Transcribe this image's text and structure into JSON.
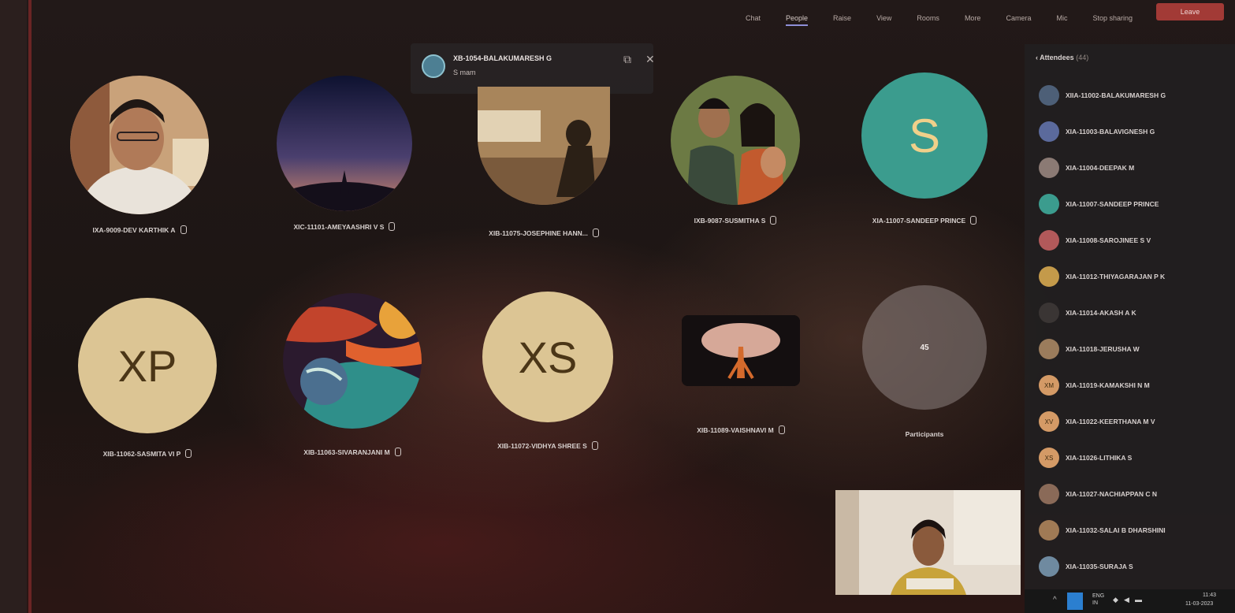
{
  "header": {
    "menu": [
      "Chat",
      "People",
      "Raise",
      "View",
      "Rooms",
      "More",
      "Camera",
      "Mic",
      "Stop sharing"
    ],
    "active_menu": "People",
    "leave_label": "Leave"
  },
  "notification": {
    "sender": "XB-1054-BALAKUMARESH G",
    "message": "S mam",
    "pop_out_icon": "pop-out-icon",
    "close_icon": "close-icon"
  },
  "tiles": [
    {
      "name": "IXA-9009-DEV KARTHIK A",
      "kind": "photo",
      "icon": "boy-photo"
    },
    {
      "name": "XIC-11101-AMEYAASHRI V S",
      "kind": "photo",
      "icon": "night-sky-photo"
    },
    {
      "name": "XIB-11075-JOSEPHINE HANN...",
      "kind": "photo",
      "icon": "sitting-person-photo"
    },
    {
      "name": "IXB-9087-SUSMITHA S",
      "kind": "photo",
      "icon": "group-selfie-photo"
    },
    {
      "name": "XIA-11007-SANDEEP PRINCE",
      "kind": "initial",
      "initials": "S",
      "color": "#3b9c8e"
    },
    {
      "name": "XIB-11062-SASMITA VI P",
      "kind": "initial",
      "initials": "XP",
      "color": "#dcc594"
    },
    {
      "name": "XIB-11063-SIVARANJANI M",
      "kind": "photo",
      "icon": "cosmic-planet-photo"
    },
    {
      "name": "XIB-11072-VIDHYA SHREE S",
      "kind": "initial",
      "initials": "XS",
      "color": "#dcc594"
    },
    {
      "name": "XIB-11089-VAISHNAVI M",
      "kind": "photo",
      "icon": "tree-photo"
    }
  ],
  "participants_tile": {
    "count": "45",
    "label": "Participants"
  },
  "attendees": {
    "title": "Attendees",
    "count": "(44)",
    "items": [
      {
        "name": "XIIA-11002-BALAKUMARESH G",
        "color": "#4d5f77"
      },
      {
        "name": "XIA-11003-BALAVIGNESH G",
        "color": "#5b6a9c"
      },
      {
        "name": "XIA-11004-DEEPAK M",
        "color": "#8b7a74"
      },
      {
        "name": "XIA-11007-SANDEEP PRINCE",
        "color": "#3b9c8e"
      },
      {
        "name": "XIA-11008-SAROJINEE S V",
        "color": "#b2595a"
      },
      {
        "name": "XIA-11012-THIYAGARAJAN P K",
        "color": "#c49a4a"
      },
      {
        "name": "XIA-11014-AKASH A K",
        "color": "#3a3534"
      },
      {
        "name": "XIA-11018-JERUSHA W",
        "color": "#9b7c5c"
      },
      {
        "name": "XIA-11019-KAMAKSHI N M",
        "color": "#d49a66",
        "initials": "XM"
      },
      {
        "name": "XIA-11022-KEERTHANA M V",
        "color": "#d49a66",
        "initials": "XV"
      },
      {
        "name": "XIA-11026-LITHIKA S",
        "color": "#d49a66",
        "initials": "XS"
      },
      {
        "name": "XIA-11027-NACHIAPPAN C N",
        "color": "#8a6a58"
      },
      {
        "name": "XIA-11032-SALAI B DHARSHINI",
        "color": "#a07a55"
      },
      {
        "name": "XIA-11035-SURAJA S",
        "color": "#6f8aa0"
      }
    ]
  },
  "taskbar": {
    "lang": "ENG\nIN",
    "time": "11:43",
    "date": "11-03-2023"
  }
}
